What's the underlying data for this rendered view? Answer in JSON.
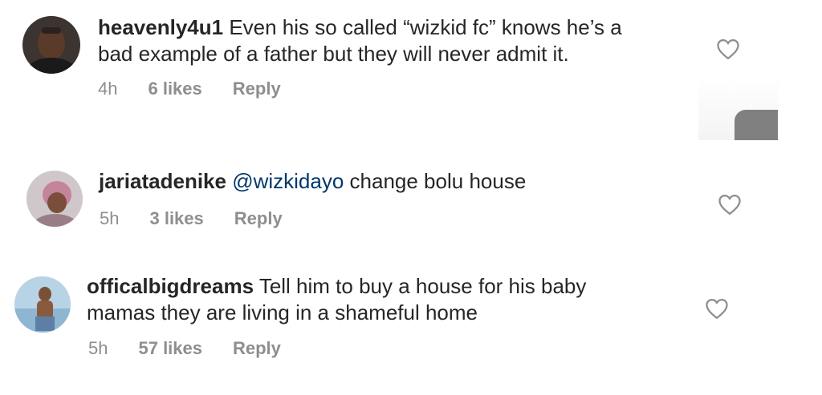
{
  "comments": [
    {
      "username": "heavenly4u1",
      "mention": "",
      "text": " Even his so called “wizkid fc” knows he’s a\nbad example of a father but they will never admit it.",
      "time": "4h",
      "likes": "6 likes",
      "reply": "Reply"
    },
    {
      "username": "jariatadenike",
      "mention": " @wizkidayo",
      "text": " change bolu house",
      "time": "5h",
      "likes": "3 likes",
      "reply": "Reply"
    },
    {
      "username": "officalbigdreams",
      "mention": "",
      "text": " Tell him to buy a house for his baby\nmamas they are living in a shameful home",
      "time": "5h",
      "likes": "57 likes",
      "reply": "Reply"
    }
  ],
  "colors": {
    "text": "#262626",
    "meta": "#8e8e8e",
    "mention": "#00376b",
    "heart_outline": "#8e8e8e"
  },
  "icons": {
    "like": "heart-outline-icon"
  }
}
